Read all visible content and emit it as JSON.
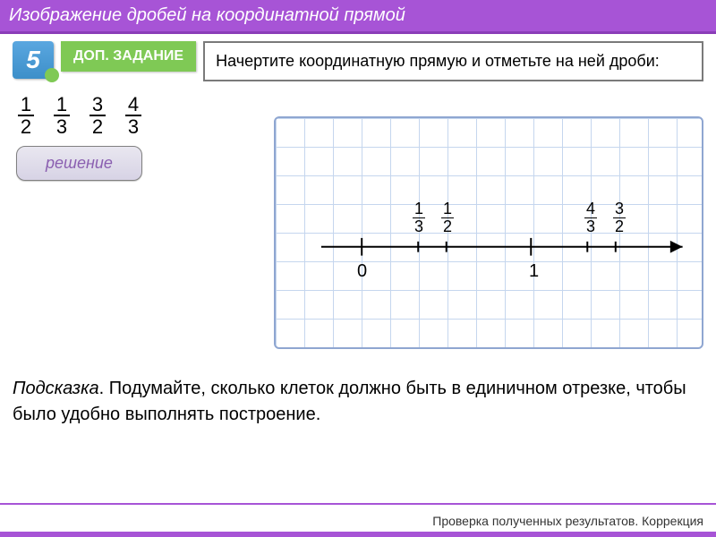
{
  "header": {
    "title": "Изображение дробей на координатной прямой"
  },
  "badge": {
    "grade": "5"
  },
  "task_badge": "ДОП. ЗАДАНИЕ",
  "task_text": "Начертите координатную прямую и отметьте на ней дроби:",
  "prompt_fractions": [
    {
      "num": "1",
      "den": "2"
    },
    {
      "num": "1",
      "den": "3"
    },
    {
      "num": "3",
      "den": "2"
    },
    {
      "num": "4",
      "den": "3"
    }
  ],
  "solution_button": "решение",
  "number_line": {
    "zero": "0",
    "one": "1",
    "marks": [
      {
        "num": "1",
        "den": "3"
      },
      {
        "num": "1",
        "den": "2"
      },
      {
        "num": "4",
        "den": "3"
      },
      {
        "num": "3",
        "den": "2"
      }
    ]
  },
  "hint": {
    "lead": "Подсказка",
    "text": ". Подумайте, сколько клеток должно быть в единичном отрезке, чтобы было удобно выполнять построение."
  },
  "footer": "Проверка полученных результатов. Коррекция",
  "chart_data": {
    "type": "line",
    "title": "number line 0 to ~1.7",
    "points_marked": [
      0,
      0.333,
      0.5,
      1,
      1.333,
      1.5
    ],
    "labels": [
      "0",
      "1/3",
      "1/2",
      "1",
      "4/3",
      "3/2"
    ],
    "xlim": [
      0,
      1.8
    ]
  }
}
